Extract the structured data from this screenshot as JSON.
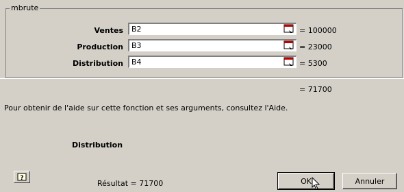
{
  "group": {
    "title": "mbrute"
  },
  "arguments": [
    {
      "label": "Ventes",
      "value": "B2",
      "result": "= 100000"
    },
    {
      "label": "Production",
      "value": "B3",
      "result": "= 23000"
    },
    {
      "label": "Distribution",
      "value": "B4",
      "result": "= 5300"
    }
  ],
  "formula_total": "= 71700",
  "help_text": "Pour obtenir de l'aide sur cette fonction et ses arguments, consultez l'Aide.",
  "argument_description": "Distribution",
  "result_label": "Résultat = 71700",
  "buttons": {
    "ok": "OK",
    "cancel": "Annuler"
  },
  "icons": {
    "collapse": "collapse-dialog-icon",
    "help": "help-icon",
    "cursor": "mouse-cursor-icon"
  },
  "colors": {
    "dialog_bg": "#d4d0c8",
    "collapse_icon_red": "#c00000"
  }
}
